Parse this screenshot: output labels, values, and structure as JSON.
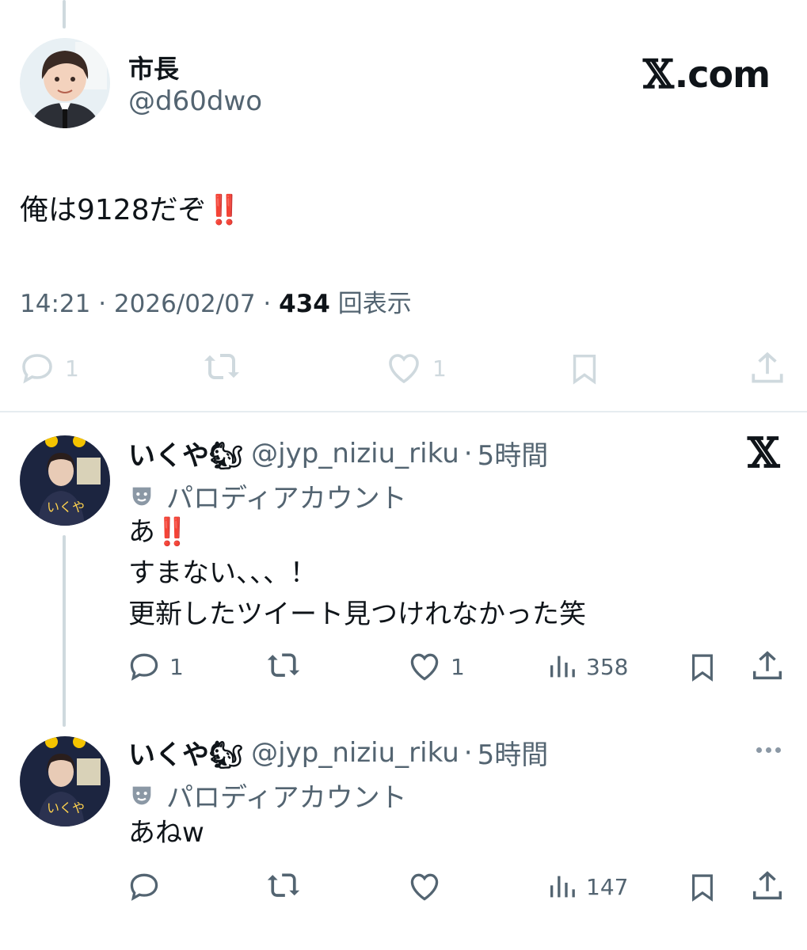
{
  "main_tweet": {
    "display_name": "市長",
    "handle": "@d60dwo",
    "brand": "𝕏.com",
    "brand_suffix": ".com",
    "text": "俺は9128だぞ",
    "emoji": "‼️",
    "timestamp": "14:21 · 2026/02/07 · ",
    "views_count": "434",
    "views_label": "回表示",
    "actions": {
      "reply_count": "1",
      "like_count": "1"
    }
  },
  "replies": [
    {
      "display_name": "いくや🐿",
      "handle": "@jyp_niziu_riku",
      "sep": "·",
      "time": "5時間",
      "parody_label": "パロディアカウント",
      "lines": [
        "あ",
        "すまない、、、！",
        "更新したツイート見つけれなかった笑"
      ],
      "first_line_emoji": "‼️",
      "actions": {
        "reply_count": "1",
        "like_count": "1",
        "views": "358"
      }
    },
    {
      "display_name": "いくや🐿",
      "handle": "@jyp_niziu_riku",
      "sep": "·",
      "time": "5時間",
      "parody_label": "パロディアカウント",
      "lines": [
        "あねw"
      ],
      "actions": {
        "views": "147"
      }
    }
  ],
  "colors": {
    "text": "#0f1419",
    "secondary": "#536471",
    "faint": "#cfd9de",
    "emoji_red": "#e0245e"
  },
  "icons": [
    "reply-icon",
    "retweet-icon",
    "like-icon",
    "bookmark-icon",
    "share-icon",
    "views-icon",
    "x-logo-icon",
    "more-icon",
    "parody-mask-icon"
  ]
}
